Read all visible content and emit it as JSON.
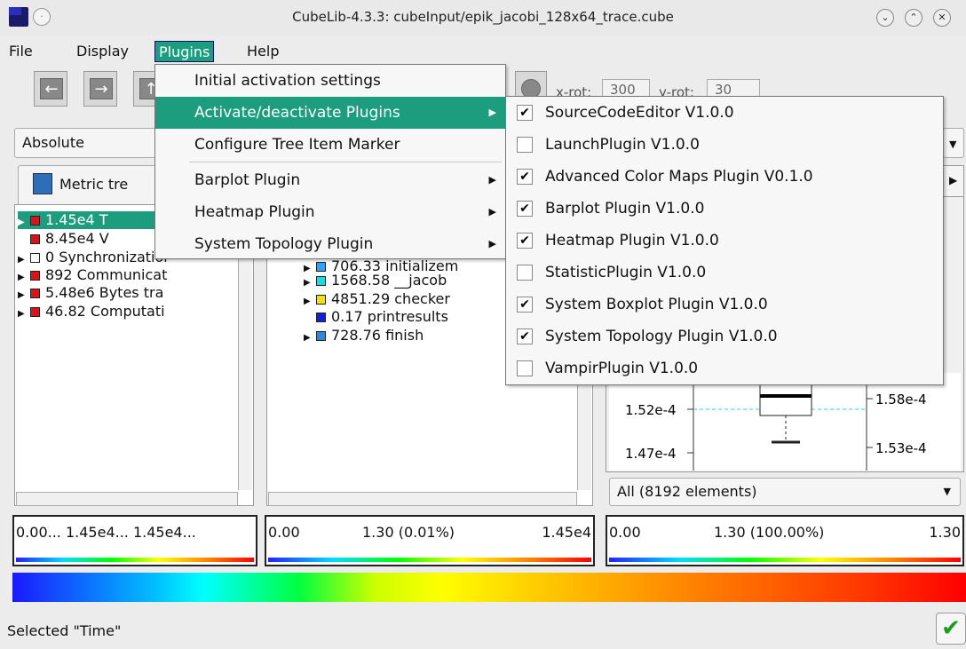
{
  "window": {
    "title": "CubeLib-4.3.3: cubeInput/epik_jacobi_128x64_trace.cube",
    "minimize_glyph": "⌄",
    "maximize_glyph": "⌃",
    "close_glyph": "✕"
  },
  "menubar": {
    "file": "File",
    "display": "Display",
    "plugins": "Plugins",
    "help": "Help"
  },
  "toolbar": {
    "xrot_label": "x-rot:",
    "xrot_value": "300",
    "yrot_label": "y-rot:",
    "yrot_value": "30"
  },
  "selectors": {
    "left": "Absolute"
  },
  "metric_tab": {
    "label": "Metric tre"
  },
  "metric_tree": [
    {
      "text": "1.45e4 T",
      "color": "#e0101a"
    },
    {
      "text": "8.45e4 V",
      "color": "#e0101a"
    },
    {
      "text": "0 Synchronizatior",
      "color": "#ffffff"
    },
    {
      "text": "892 Communicat",
      "color": "#e0101a"
    },
    {
      "text": "5.48e6 Bytes tra",
      "color": "#e0101a"
    },
    {
      "text": "46.82 Computati",
      "color": "#e0101a"
    }
  ],
  "call_tree": [
    {
      "text": "706.33 initializem",
      "color": "#2aa4ff"
    },
    {
      "text": "1568.58 __jacob",
      "color": "#10e0e0"
    },
    {
      "text": "4851.29 checker",
      "color": "#f0e010"
    },
    {
      "text": "0.17 printresults",
      "color": "#1020e0"
    },
    {
      "text": "728.76 finish",
      "color": "#2a8ae0"
    }
  ],
  "boxplot": {
    "left_labels": [
      "1.52e-4",
      "1.47e-4"
    ],
    "right_labels": [
      "1.58e-4",
      "1.53e-4"
    ],
    "filter": "All (8192 elements)"
  },
  "scales": {
    "left": "0.00... 1.45e4... 1.45e4...",
    "mid_min": "0.00",
    "mid_mid": "1.30 (0.01%)",
    "mid_max": "1.45e4",
    "right_min": "0.00",
    "right_mid": "1.30 (100.00%)",
    "right_max": "1.30"
  },
  "status": {
    "text": "Selected \"Time\""
  },
  "plugins_menu": [
    {
      "label": "Initial activation settings",
      "submenu": false
    },
    {
      "label": "Activate/deactivate Plugins",
      "submenu": true
    },
    {
      "label": "Configure Tree Item Marker",
      "submenu": false
    },
    {
      "label": "Barplot Plugin",
      "submenu": true
    },
    {
      "label": "Heatmap Plugin",
      "submenu": true
    },
    {
      "label": "System Topology Plugin",
      "submenu": true
    }
  ],
  "plugin_list": [
    {
      "label": "SourceCodeEditor V1.0.0",
      "checked": true
    },
    {
      "label": "LaunchPlugin V1.0.0",
      "checked": false
    },
    {
      "label": "Advanced Color Maps Plugin V0.1.0",
      "checked": true
    },
    {
      "label": "Barplot Plugin V1.0.0",
      "checked": true
    },
    {
      "label": "Heatmap Plugin V1.0.0",
      "checked": true
    },
    {
      "label": "StatisticPlugin V1.0.0",
      "checked": false
    },
    {
      "label": "System Boxplot Plugin V1.0.0",
      "checked": true
    },
    {
      "label": "System Topology Plugin V1.0.0",
      "checked": true
    },
    {
      "label": "VampirPlugin V1.0.0",
      "checked": false
    }
  ]
}
